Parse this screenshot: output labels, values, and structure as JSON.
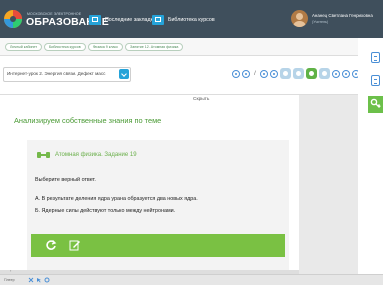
{
  "header": {
    "logo_small": "МОСКОВСКОЕ ЭЛЕКТРОННОЕ",
    "logo_big": "ОБРАЗОВАНИЕ",
    "nav": [
      {
        "label": "Последние закладки",
        "icon": "bookmark-icon"
      },
      {
        "label": "Библиотека курсов",
        "icon": "library-icon"
      }
    ],
    "user_name": "Ананец Светлана Генриховна",
    "user_role": "(Учитель)"
  },
  "breadcrumbs": [
    "Личный кабинет",
    "Библиотека курсов",
    "Физика 9 класс",
    "Занятие 12. Атомная физика"
  ],
  "lesson": {
    "select_value": "Интернет-урок 2. Энергия связи. Дефект масс"
  },
  "pager": {
    "separator": "/",
    "pills": [
      {
        "active": false
      },
      {
        "active": false
      },
      {
        "active": true
      },
      {
        "active": false
      }
    ]
  },
  "content": {
    "hide_label": "Скрыть",
    "section_title": "Анализируем собственные знания по теме",
    "task_title": "Атомная физика. Задание 19",
    "question": "Выберите верный ответ.",
    "answers": [
      "А. В результате деления ядра урана образуется два новых ядра.",
      "Б. Ядерные силы действуют только между нейтронами."
    ]
  },
  "taskbar": {
    "label": "Плеер"
  },
  "colors": {
    "header_bg": "#3f4f5c",
    "accent_green": "#7ac143",
    "accent_blue": "#25a3d9"
  }
}
